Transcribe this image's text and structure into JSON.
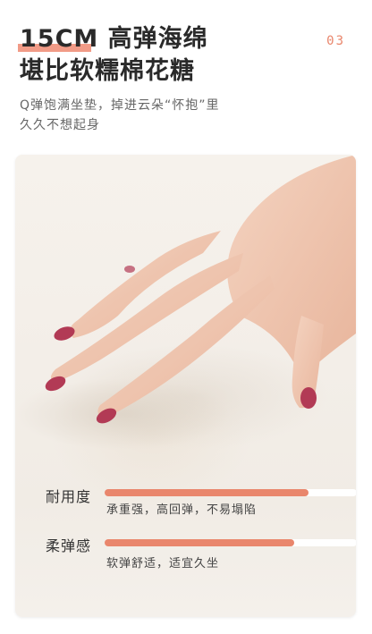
{
  "header": {
    "title_line1_highlight": "15CM",
    "title_line1_rest": "高弹海绵",
    "title_line2": "堪比软糯棉花糖",
    "page_number": "03"
  },
  "description": {
    "line1": "Q弹饱满坐垫，掉进云朵“怀抱”里",
    "line2": "久久不想起身"
  },
  "metrics": [
    {
      "label": "耐用度",
      "description": "承重强，高回弹，不易塌陷",
      "level": 0.81
    },
    {
      "label": "柔弹感",
      "description": "软弹舒适，适宜久坐",
      "level": 0.75
    }
  ],
  "colors": {
    "accent": "#e9866c",
    "nail": "#b23a55",
    "skin": "#f0c8b2"
  }
}
